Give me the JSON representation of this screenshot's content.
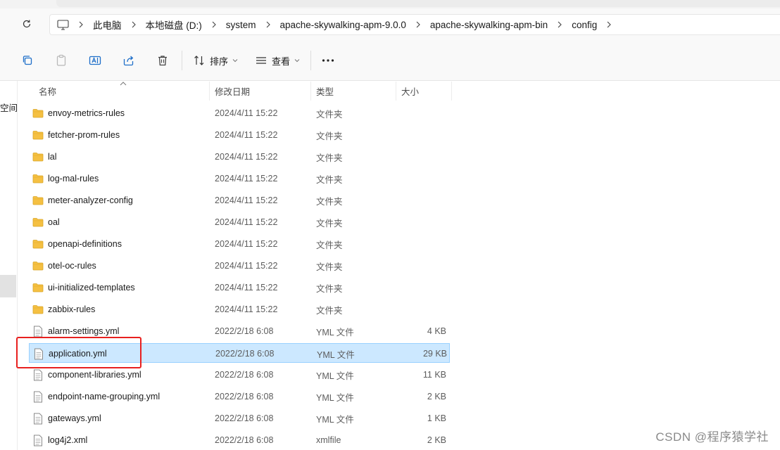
{
  "breadcrumbs": [
    "此电脑",
    "本地磁盘 (D:)",
    "system",
    "apache-skywalking-apm-9.0.0",
    "apache-skywalking-apm-bin",
    "config"
  ],
  "toolbar": {
    "sort_label": "排序",
    "view_label": "查看"
  },
  "sidebar": {
    "partial_label": "空间"
  },
  "columns": {
    "name": "名称",
    "date": "修改日期",
    "type": "类型",
    "size": "大小"
  },
  "files": [
    {
      "name": "envoy-metrics-rules",
      "date": "2024/4/11 15:22",
      "type": "文件夹",
      "size": "",
      "kind": "folder",
      "selected": false
    },
    {
      "name": "fetcher-prom-rules",
      "date": "2024/4/11 15:22",
      "type": "文件夹",
      "size": "",
      "kind": "folder",
      "selected": false
    },
    {
      "name": "lal",
      "date": "2024/4/11 15:22",
      "type": "文件夹",
      "size": "",
      "kind": "folder",
      "selected": false
    },
    {
      "name": "log-mal-rules",
      "date": "2024/4/11 15:22",
      "type": "文件夹",
      "size": "",
      "kind": "folder",
      "selected": false
    },
    {
      "name": "meter-analyzer-config",
      "date": "2024/4/11 15:22",
      "type": "文件夹",
      "size": "",
      "kind": "folder",
      "selected": false
    },
    {
      "name": "oal",
      "date": "2024/4/11 15:22",
      "type": "文件夹",
      "size": "",
      "kind": "folder",
      "selected": false
    },
    {
      "name": "openapi-definitions",
      "date": "2024/4/11 15:22",
      "type": "文件夹",
      "size": "",
      "kind": "folder",
      "selected": false
    },
    {
      "name": "otel-oc-rules",
      "date": "2024/4/11 15:22",
      "type": "文件夹",
      "size": "",
      "kind": "folder",
      "selected": false
    },
    {
      "name": "ui-initialized-templates",
      "date": "2024/4/11 15:22",
      "type": "文件夹",
      "size": "",
      "kind": "folder",
      "selected": false
    },
    {
      "name": "zabbix-rules",
      "date": "2024/4/11 15:22",
      "type": "文件夹",
      "size": "",
      "kind": "folder",
      "selected": false
    },
    {
      "name": "alarm-settings.yml",
      "date": "2022/2/18 6:08",
      "type": "YML 文件",
      "size": "4 KB",
      "kind": "file",
      "selected": false
    },
    {
      "name": "application.yml",
      "date": "2022/2/18 6:08",
      "type": "YML 文件",
      "size": "29 KB",
      "kind": "file",
      "selected": true
    },
    {
      "name": "component-libraries.yml",
      "date": "2022/2/18 6:08",
      "type": "YML 文件",
      "size": "11 KB",
      "kind": "file",
      "selected": false
    },
    {
      "name": "endpoint-name-grouping.yml",
      "date": "2022/2/18 6:08",
      "type": "YML 文件",
      "size": "2 KB",
      "kind": "file",
      "selected": false
    },
    {
      "name": "gateways.yml",
      "date": "2022/2/18 6:08",
      "type": "YML 文件",
      "size": "1 KB",
      "kind": "file",
      "selected": false
    },
    {
      "name": "log4j2.xml",
      "date": "2022/2/18 6:08",
      "type": "xmlfile",
      "size": "2 KB",
      "kind": "file",
      "selected": false
    }
  ],
  "watermark": "CSDN @程序猿学社",
  "colors": {
    "selection": "#cce8ff",
    "highlight_box": "#e8201f",
    "folder": "#f5c042"
  }
}
